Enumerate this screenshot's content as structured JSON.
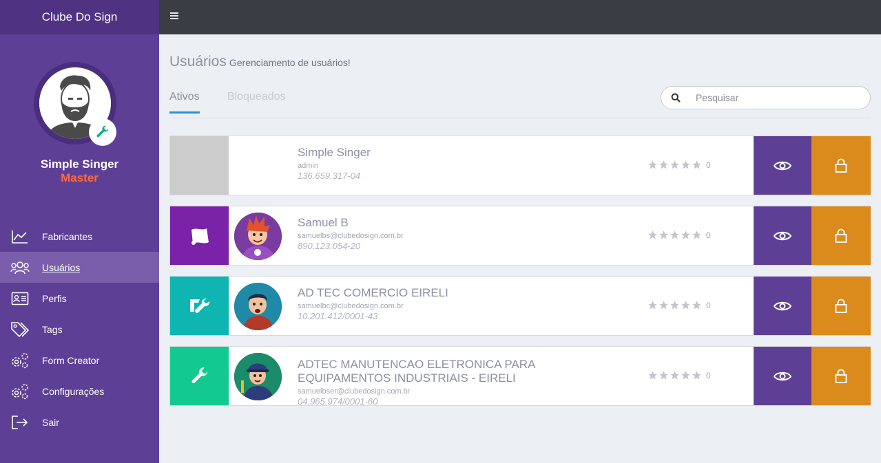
{
  "app": {
    "brand": "Clube Do Sign"
  },
  "profile": {
    "name": "Simple Singer",
    "role": "Master"
  },
  "nav": [
    {
      "label": "Fabricantes",
      "icon": "chart-icon"
    },
    {
      "label": "Usuários",
      "icon": "users-icon",
      "active": true
    },
    {
      "label": "Perfis",
      "icon": "id-card-icon"
    },
    {
      "label": "Tags",
      "icon": "tags-icon"
    },
    {
      "label": "Form Creator",
      "icon": "gears-icon"
    },
    {
      "label": "Configurações",
      "icon": "gears-icon"
    },
    {
      "label": "Sair",
      "icon": "sign-out-icon"
    }
  ],
  "page": {
    "title": "Usuários",
    "subtitle": "Gerenciamento de usuários!"
  },
  "tabs": [
    {
      "label": "Ativos",
      "active": true
    },
    {
      "label": "Bloqueados",
      "active": false
    }
  ],
  "search": {
    "placeholder": "Pesquisar",
    "value": ""
  },
  "users": [
    {
      "name": "Simple Singer",
      "email": "admin",
      "document": "136.659.317-04",
      "rating": 0,
      "tag_color": "#cccccc",
      "tag_icon": "",
      "avatar": "none"
    },
    {
      "name": "Samuel B",
      "email": "samuelbs@clubedosign.com.br",
      "document": "890.123.054-20",
      "rating": 0,
      "tag_color": "#7a22a8",
      "tag_icon": "flag-icon",
      "avatar": "red-hair-cartoon"
    },
    {
      "name": "AD TEC COMERCIO EIRELI",
      "email": "samuelbc@clubedosign.com.br",
      "document": "10.201.412/0001-43",
      "rating": 0,
      "tag_color": "#0fb5b0",
      "tag_icon": "tools-icon",
      "avatar": "technician-cartoon"
    },
    {
      "name": "ADTEC MANUTENCAO ELETRONICA PARA EQUIPAMENTOS INDUSTRIAIS - EIRELI",
      "email": "samuelbser@clubedosign.com.br",
      "document": "04.965.974/0001-60",
      "rating": 0,
      "tag_color": "#12c98f",
      "tag_icon": "wrench-icon",
      "avatar": "mechanic-cartoon"
    }
  ],
  "colors": {
    "sidebar": "#5e3f96",
    "topbar": "#3a3d44",
    "view_button": "#5e3f96",
    "lock_button": "#da8b1c",
    "role": "#ff6a3d",
    "tab_active": "#2a8fd8"
  }
}
